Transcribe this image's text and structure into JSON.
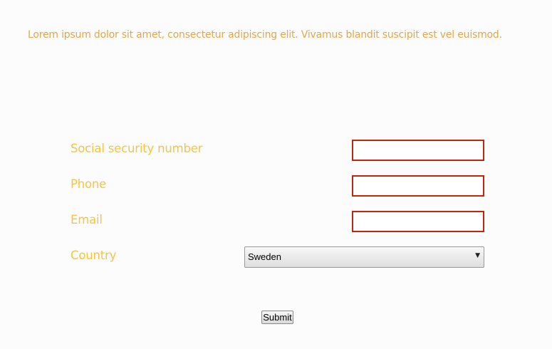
{
  "intro": {
    "text": "Lorem ipsum dolor sit amet, consectetur adipiscing elit. Vivamus blandit suscipit est vel euismod."
  },
  "form": {
    "ssn_label": "Social security number",
    "ssn_value": "",
    "phone_label": "Phone",
    "phone_value": "",
    "email_label": "Email",
    "email_value": "",
    "country_label": "Country",
    "country_selected": "Sweden",
    "submit_label": "Submit"
  },
  "icons": {
    "select_arrow": "dropdown-triangle-icon"
  },
  "colors": {
    "intro_text": "#e0a84e",
    "label_text": "#f5c542",
    "invalid_border": "#c4250e",
    "background": "#fcfcfd"
  }
}
